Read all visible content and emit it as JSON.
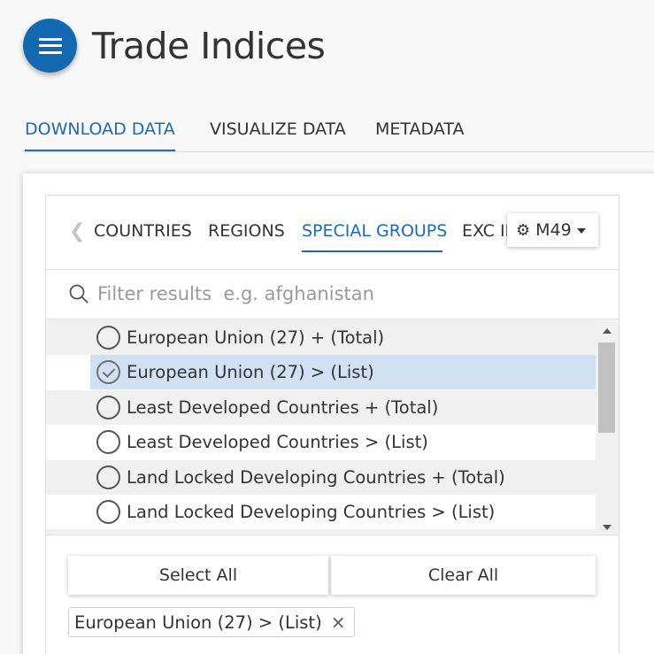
{
  "header": {
    "title": "Trade Indices",
    "menu_icon": "hamburger-menu-icon",
    "accent_color": "#1369b1"
  },
  "top_tabs": [
    {
      "label": "DOWNLOAD DATA",
      "active": true
    },
    {
      "label": "VISUALIZE DATA",
      "active": false
    },
    {
      "label": "METADATA",
      "active": false
    }
  ],
  "region_tabs": [
    {
      "label": "COUNTRIES",
      "active": false
    },
    {
      "label": "REGIONS",
      "active": false
    },
    {
      "label": "SPECIAL GROUPS",
      "active": true
    },
    {
      "label": "EXC IN",
      "active": false
    }
  ],
  "code_selector": {
    "label": "M49",
    "icon": "gear-icon"
  },
  "filter": {
    "placeholder": "Filter results  e.g. afghanistan",
    "value": ""
  },
  "list_items": [
    {
      "label": "European Union (27) + (Total)",
      "selected": false
    },
    {
      "label": "European Union (27) > (List)",
      "selected": true
    },
    {
      "label": "Least Developed Countries + (Total)",
      "selected": false
    },
    {
      "label": "Least Developed Countries > (List)",
      "selected": false
    },
    {
      "label": "Land Locked Developing Countries + (Total)",
      "selected": false
    },
    {
      "label": "Land Locked Developing Countries > (List)",
      "selected": false
    }
  ],
  "buttons": {
    "select_all": "Select All",
    "clear_all": "Clear All"
  },
  "selected_chips": [
    {
      "label": "European Union (27) > (List)",
      "remove": "×"
    }
  ]
}
